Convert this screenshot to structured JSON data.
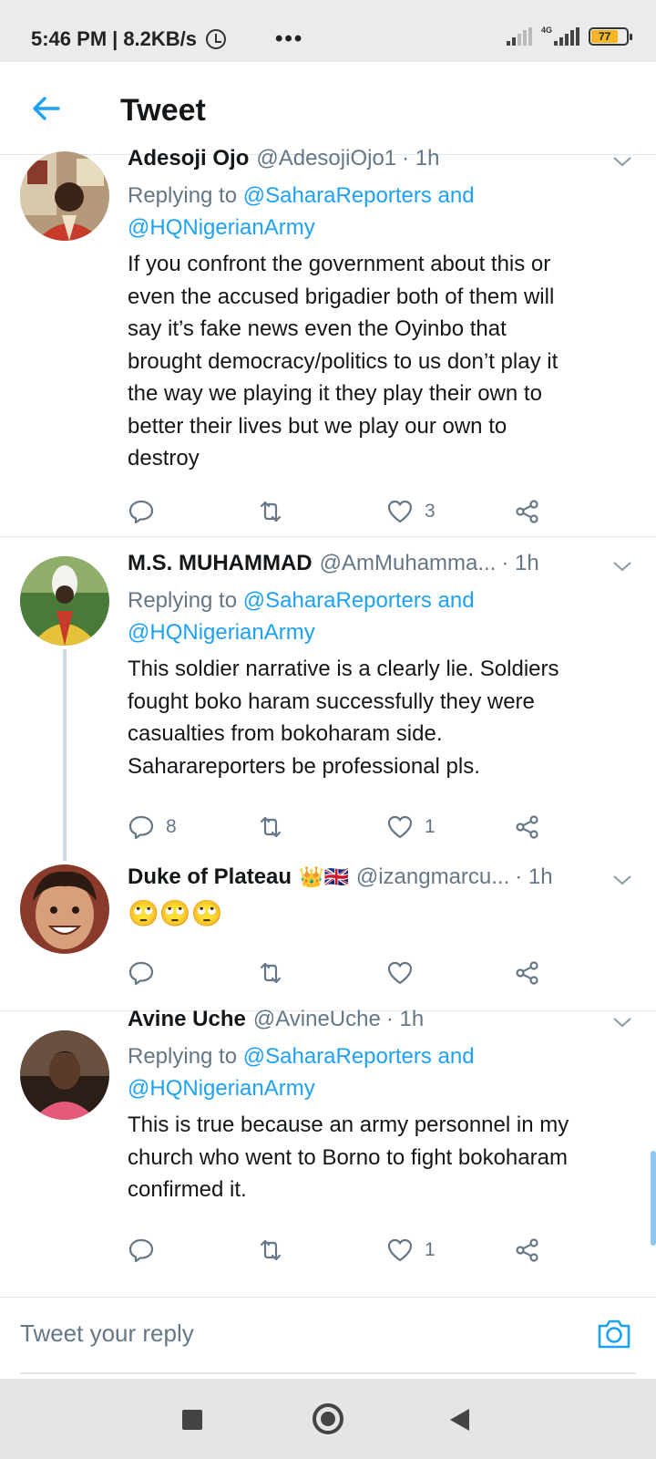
{
  "status_bar": {
    "time": "5:46 PM",
    "separator": "|",
    "speed": "8.2KB/s",
    "more": "•••",
    "network": "4G",
    "battery": "77"
  },
  "header": {
    "back_icon": "arrow-left-icon",
    "title": "Tweet"
  },
  "tweets": [
    {
      "name": "Adesoji Ojo",
      "handle": "@AdesojiOjo1",
      "time": "· 1h",
      "replying_prefix": "Replying to",
      "replying_mention1": "@SaharaReporters and",
      "replying_mention2": "@HQNigerianArmy",
      "text_lines": [
        "If you confront the government about this or",
        "even the accused brigadier both of them will",
        "say it’s fake news even the Oyinbo that",
        "brought democracy/politics to us don’t play it",
        "the way we playing it they play their own to",
        "better their lives but we play our own to",
        "destroy"
      ],
      "reply_count": "",
      "retweet_count": "",
      "like_count": "3"
    },
    {
      "name": "M.S. MUHAMMAD",
      "handle": "@AmMuhamma...",
      "time": "· 1h",
      "replying_prefix": "Replying to",
      "replying_mention1": "@SaharaReporters and",
      "replying_mention2": "@HQNigerianArmy",
      "text_lines": [
        "This soldier narrative is a clearly lie. Soldiers",
        "fought boko haram successfully they were",
        "casualties from bokoharam side.",
        "Saharareporters be professional pls."
      ],
      "reply_count": "8",
      "retweet_count": "",
      "like_count": "1"
    },
    {
      "name": "Duke of Plateau",
      "name_emoji": "👑🇬🇧",
      "handle": "@izangmarcu...",
      "time": "· 1h",
      "text_lines": [
        "🙄🙄🙄"
      ],
      "reply_count": "",
      "retweet_count": "",
      "like_count": ""
    },
    {
      "name": "Avine Uche",
      "handle": "@AvineUche",
      "time": "· 1h",
      "replying_prefix": "Replying to",
      "replying_mention1": "@SaharaReporters and",
      "replying_mention2": "@HQNigerianArmy",
      "text_lines": [
        "This is true because an army personnel in my",
        "church who went to Borno to fight bokoharam",
        "confirmed it."
      ],
      "reply_count": "",
      "retweet_count": "",
      "like_count": "1"
    }
  ],
  "reply_bar": {
    "placeholder": "Tweet your reply",
    "camera_icon": "camera-icon"
  },
  "nav_bar": {
    "recents_icon": "square-icon",
    "home_icon": "circle-icon",
    "back_icon": "triangle-back-icon"
  },
  "colors": {
    "accent": "#1da1f2",
    "text": "#14171a",
    "secondary": "#657786",
    "battery": "#f5b625"
  }
}
